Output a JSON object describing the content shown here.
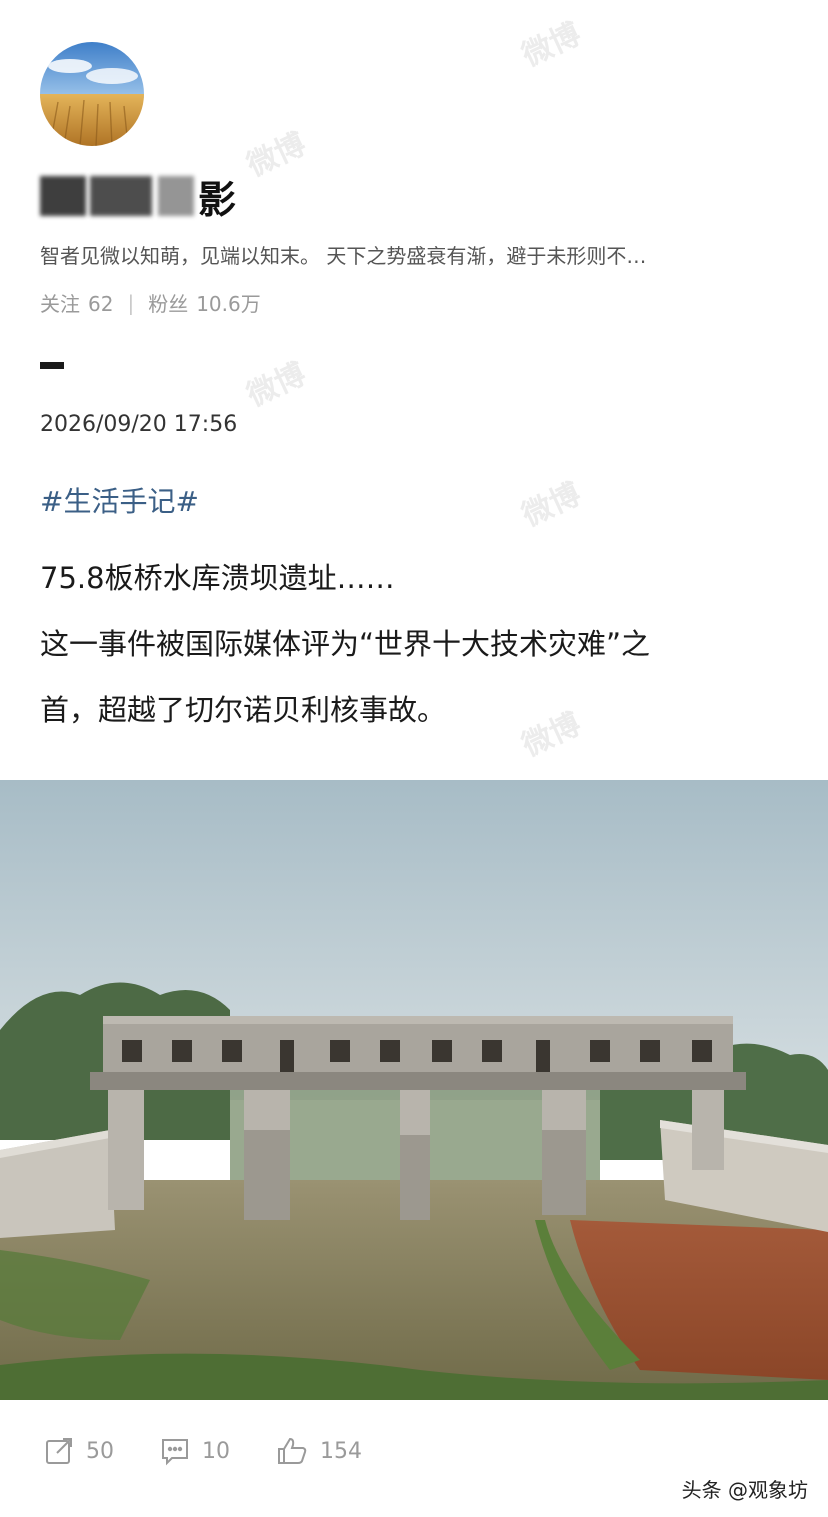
{
  "profile": {
    "avatar_icon": "wheat-field-avatar",
    "name_visible": "影",
    "bio": "智者见微以知萌，见端以知末。 天下之势盛衰有渐，避于未形则不…",
    "following_label": "关注",
    "following_count": "62",
    "stats_separator": "|",
    "followers_label": "粉丝",
    "followers_count": "10.6万"
  },
  "post": {
    "timestamp": "2026/09/20 17:56",
    "hashtag": "#生活手记#",
    "lines": [
      "75.8板桥水库溃坝遗址……",
      "这一事件被国际媒体评为“世界十大技术灾难”之",
      "首，超越了切尔诺贝利核事故。"
    ]
  },
  "actions": {
    "share": {
      "icon": "share-icon",
      "count": "50"
    },
    "comment": {
      "icon": "comment-icon",
      "count": "10"
    },
    "like": {
      "icon": "thumbs-up-icon",
      "count": "154"
    }
  },
  "branding": "头条 @观象坊",
  "watermark": "微博",
  "colors": {
    "hashtag": "#3b5f86",
    "muted": "#9a9a9a",
    "text": "#1a1a1a"
  }
}
